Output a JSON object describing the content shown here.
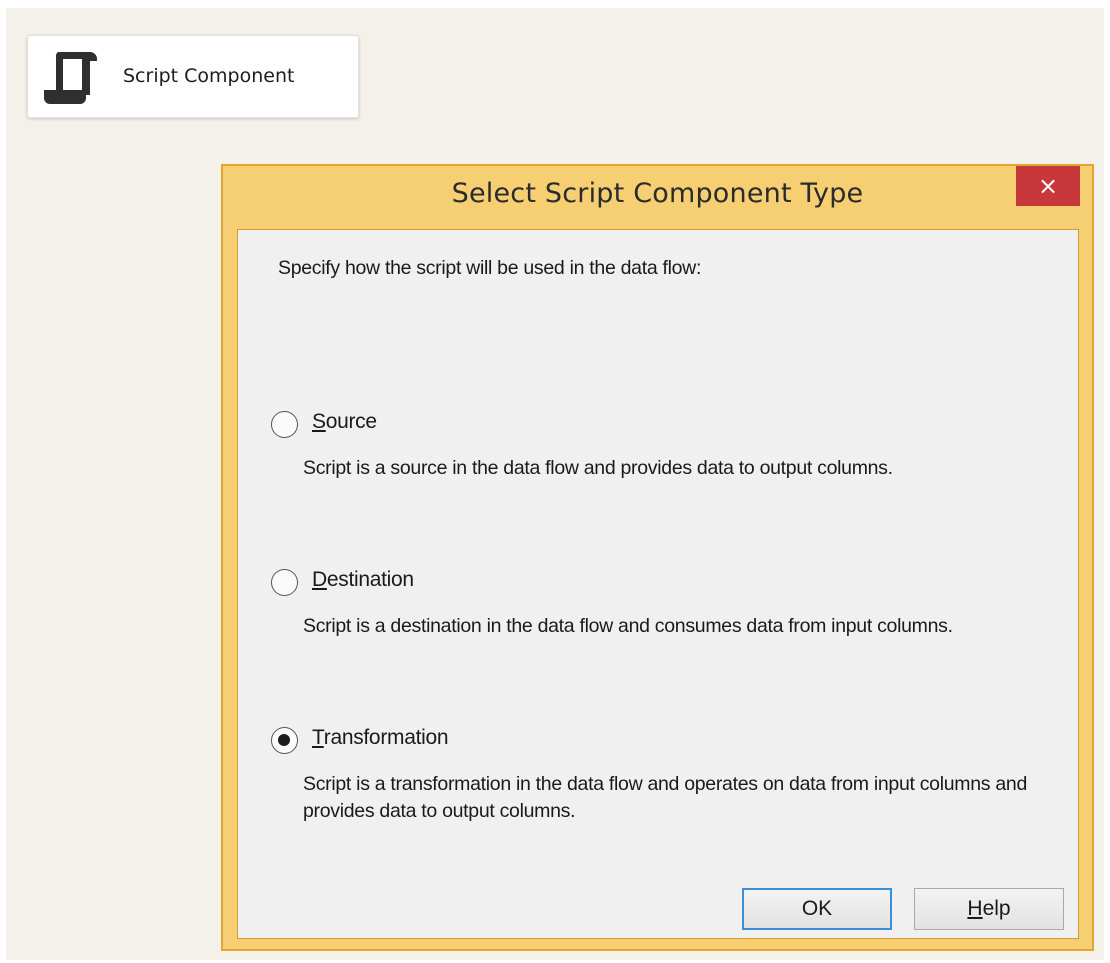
{
  "component": {
    "label": "Script Component",
    "icon": "script-scroll-icon"
  },
  "dialog": {
    "title": "Select Script Component Type",
    "close_icon": "×",
    "intro": "Specify how the script will be used in the data flow:",
    "selected": "Transformation",
    "options": [
      {
        "label_mnemonic": "S",
        "label_rest": "ource",
        "description": "Script is a source in the data flow and provides data to output columns.",
        "checked": false
      },
      {
        "label_mnemonic": "D",
        "label_rest": "estination",
        "description": "Script is a destination in the data flow and consumes data from input columns.",
        "checked": false
      },
      {
        "label_mnemonic": "T",
        "label_rest": "ransformation",
        "description": "Script is a transformation in the data flow and operates on data from input columns and provides data to output columns.",
        "checked": true
      }
    ],
    "ok_label": "OK",
    "help_mnemonic": "H",
    "help_rest": "elp"
  }
}
